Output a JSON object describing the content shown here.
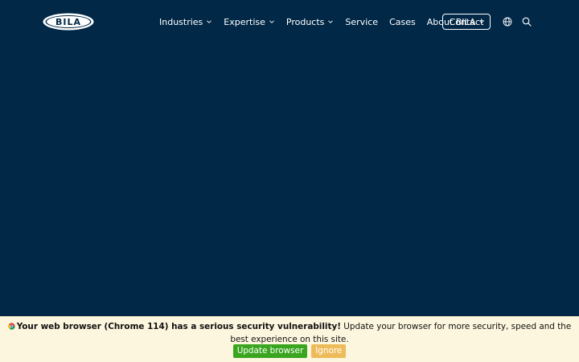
{
  "header": {
    "logo_text": "BILA",
    "nav": [
      {
        "label": "Industries",
        "has_dropdown": true
      },
      {
        "label": "Expertise",
        "has_dropdown": true
      },
      {
        "label": "Products",
        "has_dropdown": true
      },
      {
        "label": "Service",
        "has_dropdown": false
      },
      {
        "label": "Cases",
        "has_dropdown": false
      },
      {
        "label": "About BILA",
        "has_dropdown": true
      }
    ],
    "contact_label": "Contact",
    "icons": [
      "globe-icon",
      "search-icon"
    ]
  },
  "banner": {
    "icon": "chrome-icon",
    "headline": "Your web browser (Chrome 114) has a serious security vulnerability!",
    "message": "Update your browser for more security, speed and the best experience on this site.",
    "update_label": "Update browser",
    "ignore_label": "Ignore"
  },
  "colors": {
    "background": "#012847",
    "banner_bg": "#fdf6de",
    "update_button": "#3aa61f",
    "ignore_button": "#eebb5a"
  }
}
